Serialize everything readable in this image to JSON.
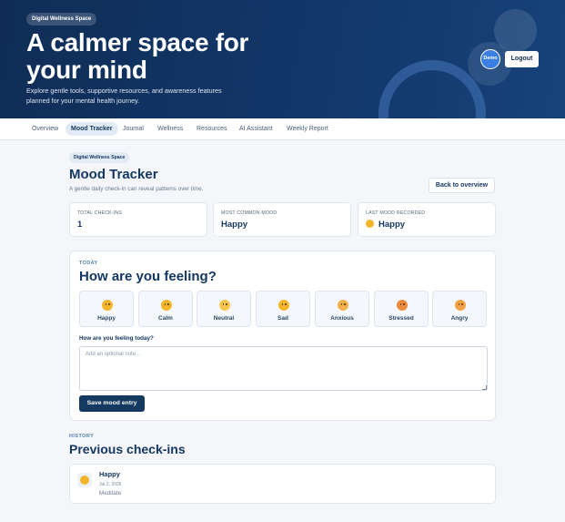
{
  "hero": {
    "badge": "Digital Wellness Space",
    "title": "A calmer space for your mind",
    "subtitle": "Explore gentle tools, supportive resources, and awareness features planned for your mental health journey.",
    "user_label": "Demo",
    "logout_label": "Logout"
  },
  "nav": {
    "tabs": [
      {
        "label": "Overview",
        "active": false
      },
      {
        "label": "Mood Tracker",
        "active": true
      },
      {
        "label": "Journal",
        "active": false
      },
      {
        "label": "Wellness",
        "active": false
      },
      {
        "label": "Resources",
        "active": false
      },
      {
        "label": "AI Assistant",
        "active": false
      },
      {
        "label": "Weekly Report",
        "active": false
      }
    ]
  },
  "page": {
    "badge": "Digital Wellness Space",
    "title": "Mood Tracker",
    "subtitle": "A gentle daily check-in can reveal patterns over time.",
    "back_label": "Back to overview"
  },
  "stats": [
    {
      "label": "TOTAL CHECK-INS",
      "value": "1"
    },
    {
      "label": "MOST COMMON MOOD",
      "value": "Happy"
    },
    {
      "label": "LAST MOOD RECORDED",
      "value": "Happy",
      "icon": "happy-face-icon"
    }
  ],
  "mood_form": {
    "eyebrow": "TODAY",
    "title": "How are you feeling?",
    "options": [
      {
        "label": "Happy",
        "icon": "happy-face-icon",
        "color": "#f5b52a"
      },
      {
        "label": "Calm",
        "icon": "calm-face-icon",
        "color": "#f5b52a"
      },
      {
        "label": "Neutral",
        "icon": "neutral-face-icon",
        "color": "#f7c64b"
      },
      {
        "label": "Sad",
        "icon": "sad-face-icon",
        "color": "#f5b52a"
      },
      {
        "label": "Anxious",
        "icon": "anxious-face-icon",
        "color": "#f2b04a"
      },
      {
        "label": "Stressed",
        "icon": "stressed-face-icon",
        "color": "#ec8a3e"
      },
      {
        "label": "Angry",
        "icon": "angry-face-icon",
        "color": "#f2a244"
      }
    ],
    "note_label": "How are you feeling today?",
    "note_placeholder": "Add an optional note...",
    "note_value": "",
    "save_label": "Save mood entry"
  },
  "history": {
    "eyebrow": "HISTORY",
    "title": "Previous check-ins",
    "entries": [
      {
        "mood": "Happy",
        "date": "Jul 2, 2026",
        "note": "Meditate",
        "icon": "happy-face-icon"
      }
    ]
  },
  "colors": {
    "hero_bg": "#12376a",
    "primary": "#143861",
    "accent": "#3b7fe3",
    "page_bg": "#f4f6f9"
  }
}
